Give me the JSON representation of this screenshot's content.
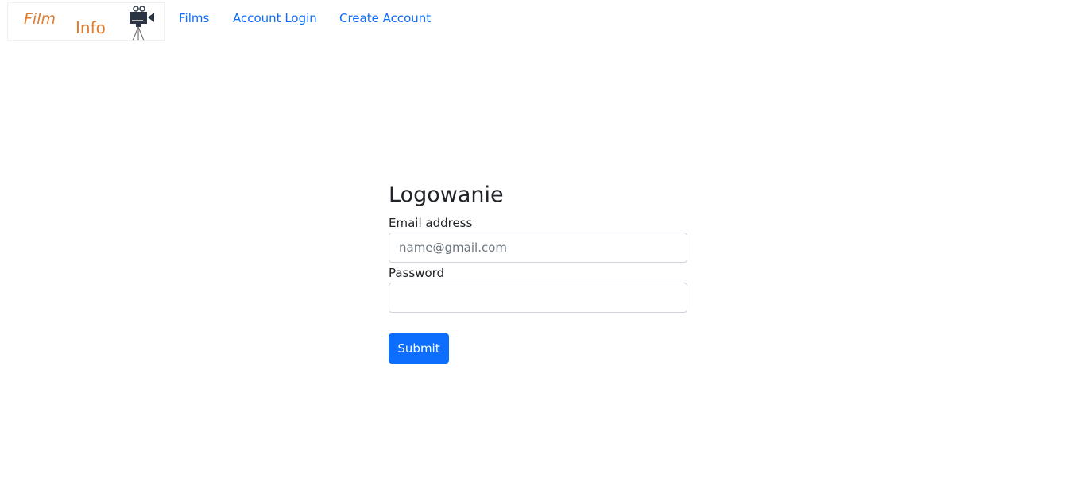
{
  "logo": {
    "word1": "Film",
    "word2": "Info",
    "icon": "movie-camera-icon"
  },
  "nav": [
    {
      "label": "Films"
    },
    {
      "label": "Account Login"
    },
    {
      "label": "Create Account"
    }
  ],
  "form": {
    "title": "Logowanie",
    "email_label": "Email address",
    "email_placeholder": "name@gmail.com",
    "email_value": "",
    "password_label": "Password",
    "password_value": "",
    "submit_label": "Submit"
  },
  "colors": {
    "accent": "#0d6efd",
    "logo": "#e07b2e"
  }
}
